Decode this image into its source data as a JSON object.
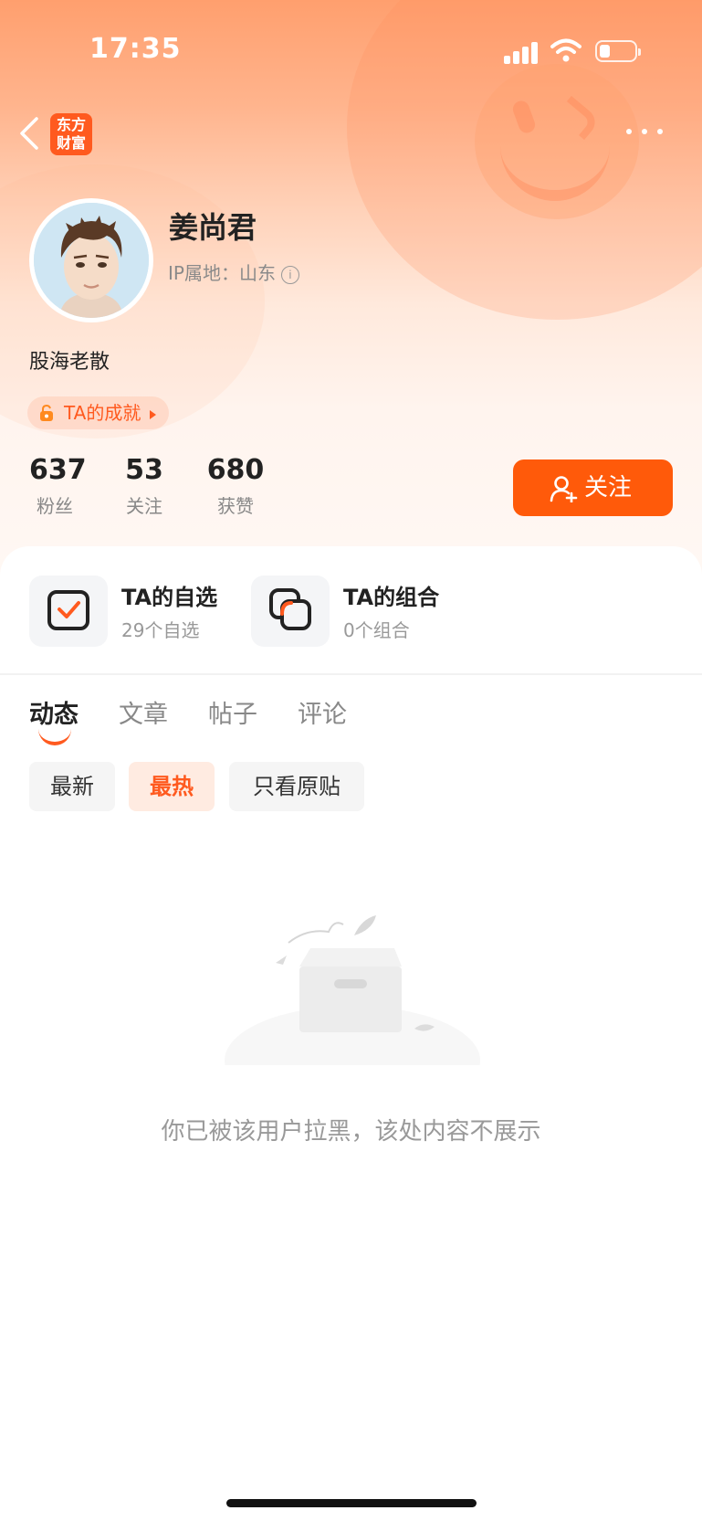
{
  "status_bar": {
    "time": "17:35"
  },
  "header": {
    "logo_text_line1": "东方",
    "logo_text_line2": "财富"
  },
  "profile": {
    "name": "姜尚君",
    "ip_location": "IP属地：山东",
    "bio": "股海老散",
    "achievement_label": "TA的成就"
  },
  "stats": [
    {
      "value": "637",
      "label": "粉丝"
    },
    {
      "value": "53",
      "label": "关注"
    },
    {
      "value": "680",
      "label": "获赞"
    }
  ],
  "follow_button": {
    "label": "关注"
  },
  "shortcuts": [
    {
      "title": "TA的自选",
      "subtitle": "29个自选"
    },
    {
      "title": "TA的组合",
      "subtitle": "0个组合"
    }
  ],
  "tabs": [
    {
      "label": "动态",
      "active": true
    },
    {
      "label": "文章",
      "active": false
    },
    {
      "label": "帖子",
      "active": false
    },
    {
      "label": "评论",
      "active": false
    }
  ],
  "filters": [
    {
      "label": "最新",
      "active": false
    },
    {
      "label": "最热",
      "active": true
    },
    {
      "label": "只看原贴",
      "active": false
    }
  ],
  "empty_state": {
    "message": "你已被该用户拉黑，该处内容不展示"
  },
  "colors": {
    "accent": "#ff5a0a",
    "hero_top": "#ff9f6e"
  }
}
